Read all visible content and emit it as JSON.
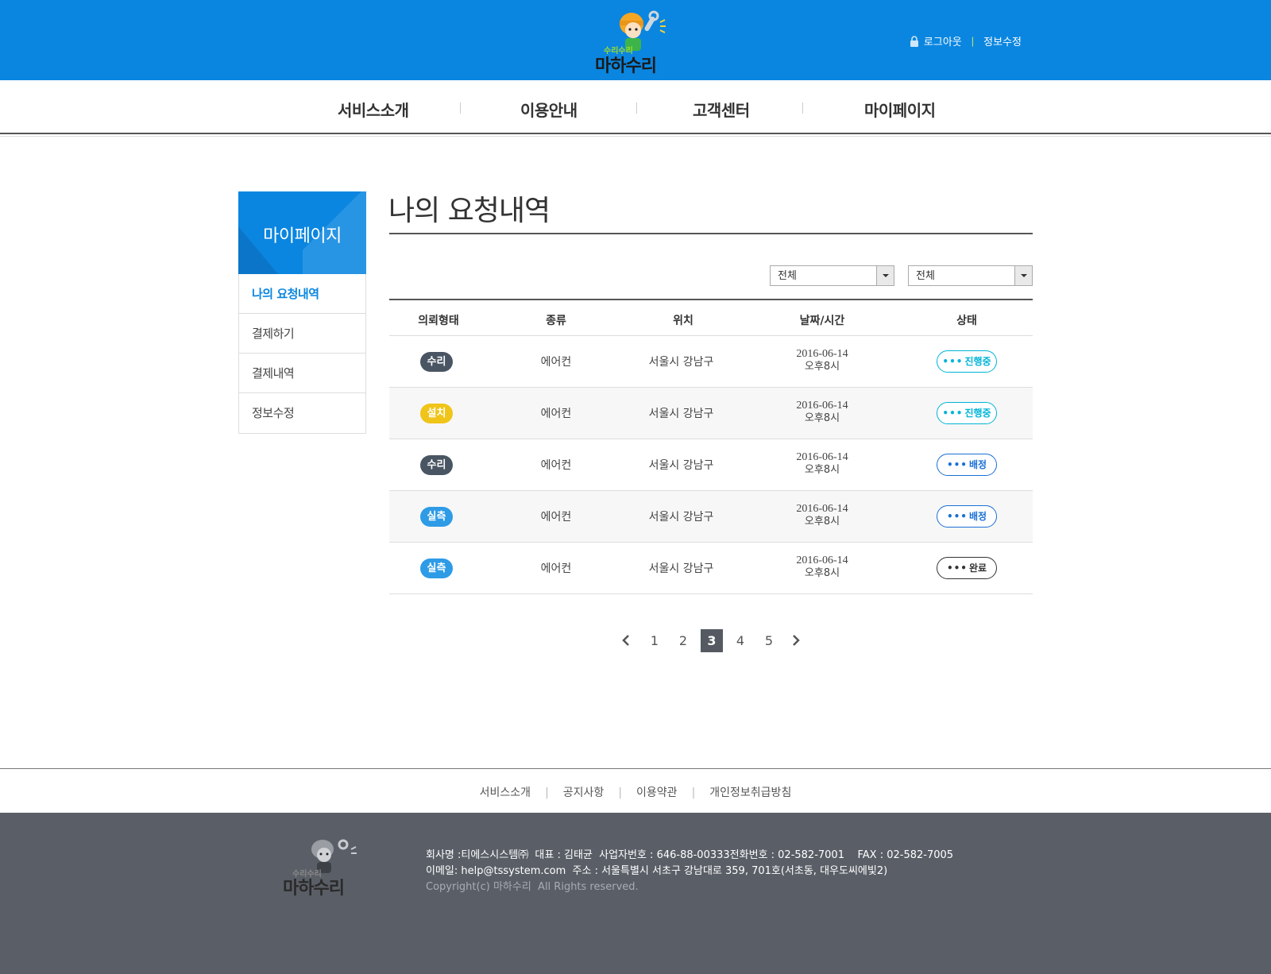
{
  "header": {
    "logo_small_text": "수리수리",
    "logo_text": "마하수리",
    "logout_label": "로그아웃",
    "edit_info_label": "정보수정",
    "colors": {
      "brand_blue": "#0a86e0",
      "accent_green": "#b6e86a"
    }
  },
  "nav": {
    "items": [
      {
        "label": "서비스소개"
      },
      {
        "label": "이용안내"
      },
      {
        "label": "고객센터"
      },
      {
        "label": "마이페이지"
      }
    ]
  },
  "sidebar": {
    "title": "마이페이지",
    "items": [
      {
        "label": "나의 요청내역",
        "active": true
      },
      {
        "label": "결제하기",
        "active": false
      },
      {
        "label": "결제내역",
        "active": false
      },
      {
        "label": "정보수정",
        "active": false
      }
    ]
  },
  "main": {
    "title": "나의 요청내역",
    "filters": [
      {
        "selected": "전체"
      },
      {
        "selected": "전체"
      }
    ],
    "table": {
      "headers": [
        "의뢰형태",
        "종류",
        "위치",
        "날짜/시간",
        "상태"
      ],
      "rows": [
        {
          "type": "수리",
          "type_color": "#4a5563",
          "kind": "에어컨",
          "location": "서울시 강남구",
          "date": "2016-06-14",
          "time": "오후8시",
          "status": "진행중",
          "status_color": "#00b4d8"
        },
        {
          "type": "설치",
          "type_color": "#f0c419",
          "kind": "에어컨",
          "location": "서울시 강남구",
          "date": "2016-06-14",
          "time": "오후8시",
          "status": "진행중",
          "status_color": "#00b4d8"
        },
        {
          "type": "수리",
          "type_color": "#4a5563",
          "kind": "에어컨",
          "location": "서울시 강남구",
          "date": "2016-06-14",
          "time": "오후8시",
          "status": "배정",
          "status_color": "#1a6fd6"
        },
        {
          "type": "실측",
          "type_color": "#2e9be6",
          "kind": "에어컨",
          "location": "서울시 강남구",
          "date": "2016-06-14",
          "time": "오후8시",
          "status": "배정",
          "status_color": "#1a6fd6"
        },
        {
          "type": "실측",
          "type_color": "#2e9be6",
          "kind": "에어컨",
          "location": "서울시 강남구",
          "date": "2016-06-14",
          "time": "오후8시",
          "status": "완료",
          "status_color": "#333333"
        }
      ]
    },
    "pagination": {
      "prev_icon": "chevron-left-icon",
      "next_icon": "chevron-right-icon",
      "pages": [
        "1",
        "2",
        "3",
        "4",
        "5"
      ],
      "current": "3"
    }
  },
  "footer": {
    "links": [
      "서비스소개",
      "공지사항",
      "이용약관",
      "개인정보취급방침"
    ],
    "logo_small_text": "수리수리",
    "logo_text": "마하수리",
    "company_line": "회사명 :티에스시스템㈜  대표 : 김태균  사업자번호 : 646-88-00333전화번호 : 02-582-7001    FAX : 02-582-7005",
    "contact_line": "이메일: help@tssystem.com  주소 : 서울특별시 서초구 강남대로 359, 701호(서초동, 대우도씨에빛2)",
    "copyright": "Copyright(c) 마하수리  All Rights reserved."
  }
}
